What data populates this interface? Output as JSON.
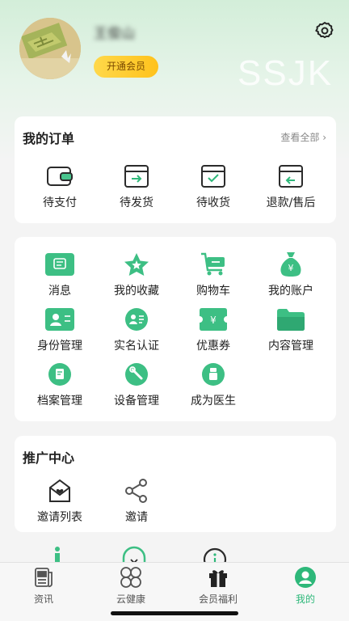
{
  "profile": {
    "username": "王俊山",
    "vip_button": "开通会员",
    "watermark": "SSJK"
  },
  "orders": {
    "title": "我的订单",
    "view_all": "查看全部",
    "items": [
      {
        "label": "待支付",
        "icon": "wallet-icon"
      },
      {
        "label": "待发货",
        "icon": "box-arrow-icon"
      },
      {
        "label": "待收货",
        "icon": "box-check-icon"
      },
      {
        "label": "退款/售后",
        "icon": "box-return-icon"
      }
    ]
  },
  "services": {
    "items": [
      {
        "label": "消息",
        "icon": "message-icon"
      },
      {
        "label": "我的收藏",
        "icon": "star-icon"
      },
      {
        "label": "购物车",
        "icon": "cart-icon"
      },
      {
        "label": "我的账户",
        "icon": "money-bag-icon"
      },
      {
        "label": "身份管理",
        "icon": "id-card-icon"
      },
      {
        "label": "实名认证",
        "icon": "user-verify-icon"
      },
      {
        "label": "优惠券",
        "icon": "coupon-icon"
      },
      {
        "label": "内容管理",
        "icon": "folder-icon"
      },
      {
        "label": "档案管理",
        "icon": "archive-icon"
      },
      {
        "label": "设备管理",
        "icon": "wrench-icon"
      },
      {
        "label": "成为医生",
        "icon": "doctor-icon"
      }
    ]
  },
  "promo": {
    "title": "推广中心",
    "items": [
      {
        "label": "邀请列表",
        "icon": "invite-envelope-icon"
      },
      {
        "label": "邀请",
        "icon": "share-icon"
      }
    ]
  },
  "tabbar": {
    "items": [
      {
        "label": "资讯",
        "icon": "news-icon"
      },
      {
        "label": "云健康",
        "icon": "clover-icon"
      },
      {
        "label": "会员福利",
        "icon": "gift-icon"
      },
      {
        "label": "我的",
        "icon": "user-circle-icon"
      }
    ],
    "active": "我的"
  },
  "colors": {
    "accent": "#2eb87a",
    "vip": "#ffc21c"
  }
}
